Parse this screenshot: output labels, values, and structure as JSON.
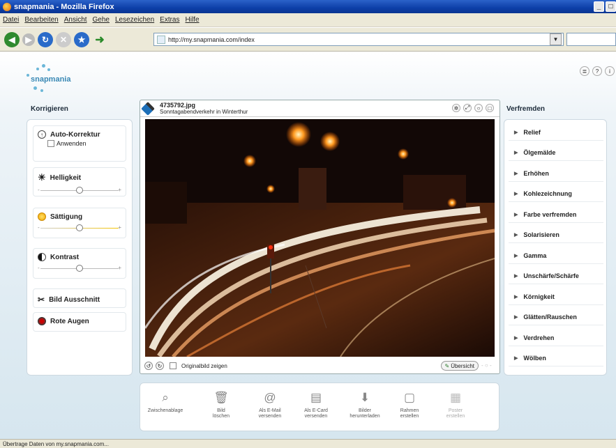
{
  "window": {
    "title": "snapmania - Mozilla Firefox",
    "buttons": [
      "_",
      "□"
    ]
  },
  "menubar": {
    "items": [
      "Datei",
      "Bearbeiten",
      "Ansicht",
      "Gehe",
      "Lesezeichen",
      "Extras",
      "Hilfe"
    ]
  },
  "navbar": {
    "url": "http://my.snapmania.com/index"
  },
  "logo": {
    "text": "snapmania"
  },
  "helpicons": [
    "≣",
    "?",
    "i"
  ],
  "left": {
    "heading": "Korrigieren",
    "auto": {
      "title": "Auto-Korrektur",
      "checkbox_label": "Anwenden"
    },
    "helligkeit": {
      "title": "Helligkeit",
      "level": 0.5
    },
    "saettigung": {
      "title": "Sättigung",
      "level": 0.5
    },
    "kontrast": {
      "title": "Kontrast",
      "level": 0.5
    },
    "ausschnitt": {
      "title": "Bild Ausschnitt"
    },
    "rote_augen": {
      "title": "Rote Augen"
    }
  },
  "image": {
    "filename": "4735792.jpg",
    "description": "Sonntagabendverkehr in Winterthur",
    "footer_checkbox_label": "Originalbild zeigen",
    "overview_label": "Übersicht"
  },
  "right": {
    "heading": "Verfremden",
    "items": [
      "Relief",
      "Ölgemälde",
      "Erhöhen",
      "Kohlezeichnung",
      "Farbe verfremden",
      "Solarisieren",
      "Gamma",
      "Unschärfe/Schärfe",
      "Körnigkeit",
      "Glätten/Rauschen",
      "Verdrehen",
      "Wölben"
    ]
  },
  "bottom": {
    "items": [
      {
        "label1": "",
        "label2": "Zwischenablage",
        "icon": "clipboard-icon"
      },
      {
        "label1": "Bild",
        "label2": "löschen",
        "icon": "trash-icon"
      },
      {
        "label1": "Als E-Mail",
        "label2": "versenden",
        "icon": "email-icon"
      },
      {
        "label1": "Als E-Card",
        "label2": "versenden",
        "icon": "ecard-icon"
      },
      {
        "label1": "Bilder",
        "label2": "herunterladen",
        "icon": "download-icon"
      },
      {
        "label1": "Rahmen",
        "label2": "erstellen",
        "icon": "frame-icon"
      },
      {
        "label1": "Poster",
        "label2": "erstellen",
        "icon": "poster-icon"
      }
    ]
  },
  "status": {
    "text": "Übertrage Daten von my.snapmania.com..."
  }
}
